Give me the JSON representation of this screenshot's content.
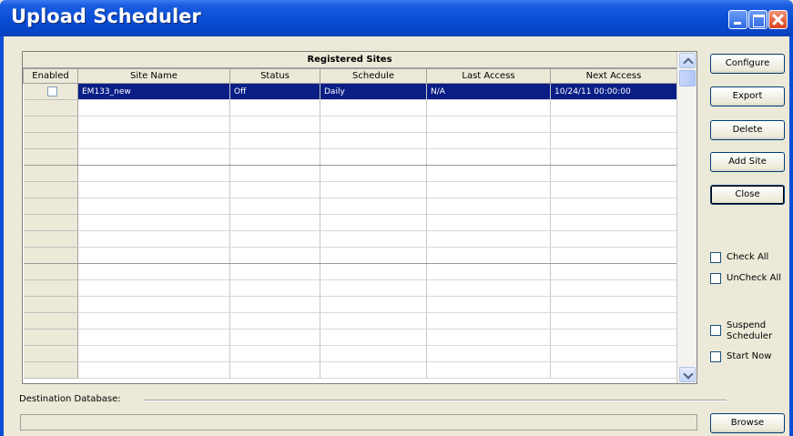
{
  "window": {
    "title": "Upload Scheduler"
  },
  "grid": {
    "caption": "Registered Sites",
    "columns": [
      "Enabled",
      "Site Name",
      "Status",
      "Schedule",
      "Last Access",
      "Next Access"
    ],
    "rows": [
      {
        "enabled": false,
        "site_name": "EM133_new",
        "status": "Off",
        "schedule": "Daily",
        "last_access": "N/A",
        "next_access": "10/24/11 00:00:00",
        "selected": true
      }
    ],
    "empty_row_count": 17
  },
  "buttons": {
    "configure": "Configure",
    "export": "Export",
    "delete": "Delete",
    "add_site": "Add Site",
    "close": "Close",
    "browse": "Browse"
  },
  "checkboxes": {
    "check_all": "Check All",
    "uncheck_all": "UnCheck All",
    "suspend_scheduler_line1": "Suspend",
    "suspend_scheduler_line2": "Scheduler",
    "start_now": "Start Now"
  },
  "destination": {
    "label": "Destination Database:",
    "value": ""
  },
  "colors": {
    "titlebar": "#0a4ed6",
    "selection": "#0a1e86",
    "window_bg": "#ece9d8"
  }
}
